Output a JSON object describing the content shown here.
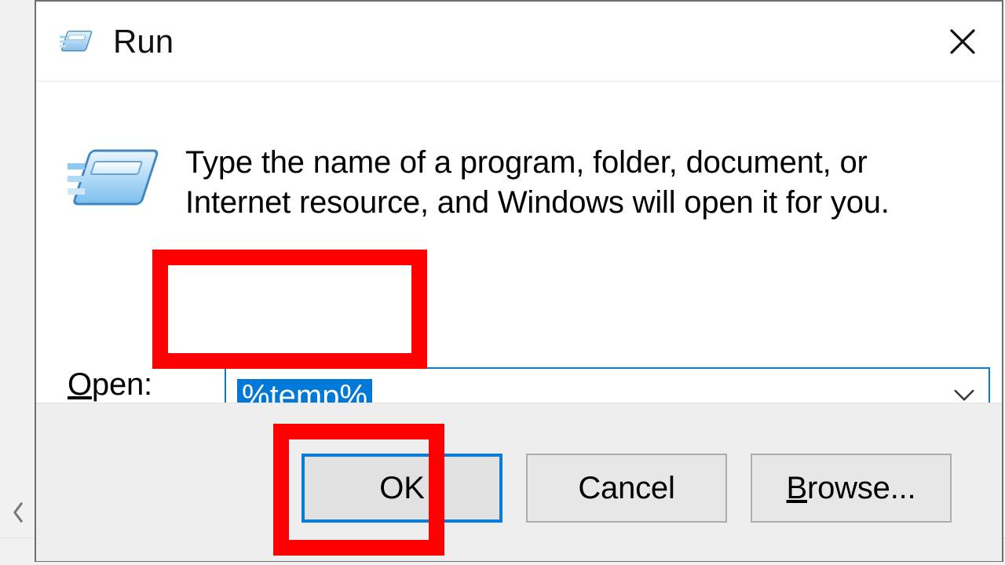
{
  "title": "Run",
  "hint": "Type the name of a program, folder, document, or Internet resource, and Windows will open it for you.",
  "open_label_letter": "O",
  "open_label_rest": "pen:",
  "combo_value": "%temp%",
  "buttons": {
    "ok": "OK",
    "cancel": "Cancel",
    "browse_letter": "B",
    "browse_rest": "rowse..."
  }
}
